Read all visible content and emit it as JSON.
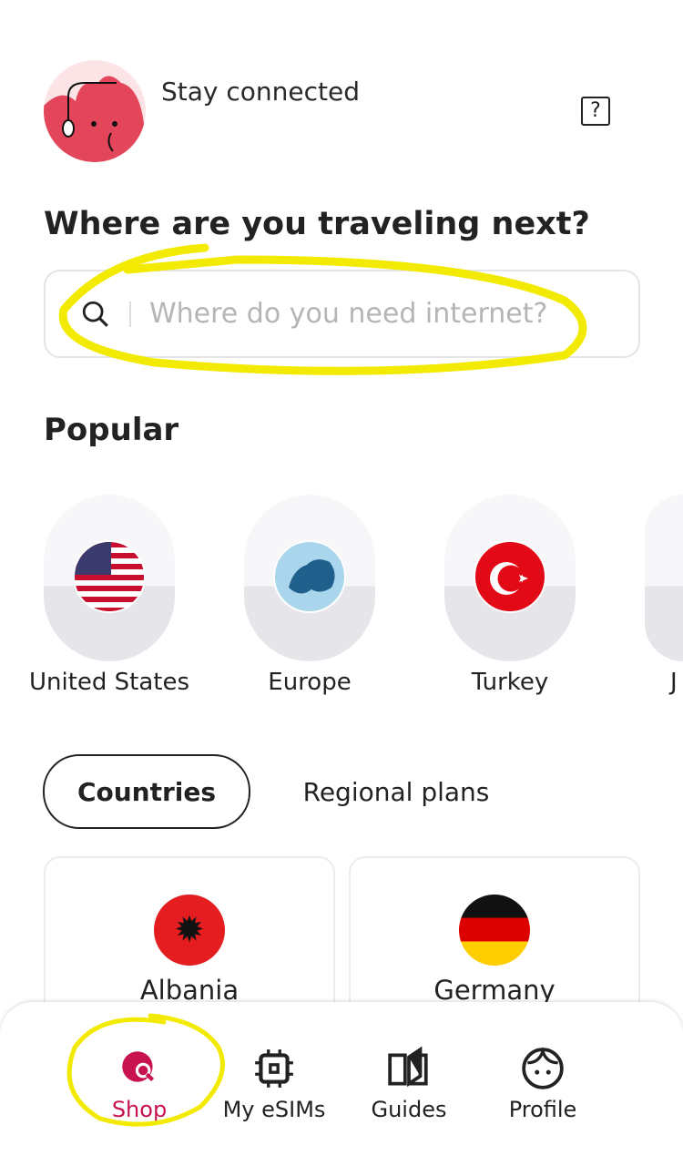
{
  "header": {
    "greeting": "Stay connected",
    "help_icon": "question-mark-icon"
  },
  "title": "Where are you traveling next?",
  "search": {
    "placeholder": "Where do you need internet?",
    "icon": "search-icon"
  },
  "popular": {
    "heading": "Popular",
    "items": [
      {
        "label": "United States"
      },
      {
        "label": "Europe"
      },
      {
        "label": "Turkey"
      },
      {
        "label": "J"
      }
    ]
  },
  "tabs": [
    {
      "label": "Countries",
      "active": true
    },
    {
      "label": "Regional plans",
      "active": false
    }
  ],
  "countries": [
    {
      "label": "Albania"
    },
    {
      "label": "Germany"
    }
  ],
  "nav": {
    "items": [
      {
        "label": "Shop",
        "icon": "globe-search-icon",
        "active": true
      },
      {
        "label": "My eSIMs",
        "icon": "chip-icon"
      },
      {
        "label": "Guides",
        "icon": "book-icon"
      },
      {
        "label": "Profile",
        "icon": "face-icon"
      }
    ]
  },
  "colors": {
    "accent": "#c8124f",
    "annotation": "#f2ea00",
    "avatar": "#e3465a"
  }
}
